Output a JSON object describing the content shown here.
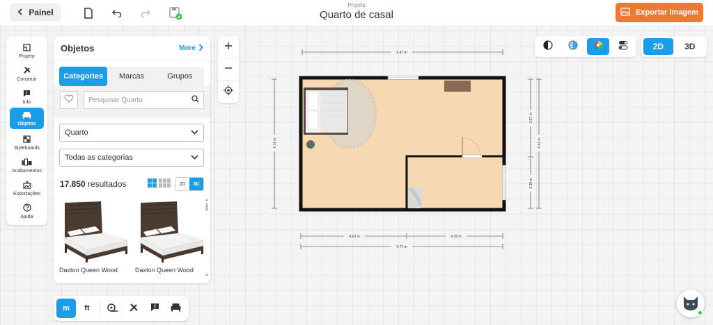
{
  "header": {
    "back_label": "Painel",
    "project_label": "Projeto",
    "project_title": "Quarto de casal",
    "export_label": "Exportar Imagem"
  },
  "sidebar": {
    "items": [
      {
        "label": "Projeto",
        "icon": "project-icon"
      },
      {
        "label": "Construir",
        "icon": "tools-icon"
      },
      {
        "label": "Info",
        "icon": "info-icon"
      },
      {
        "label": "Objetos",
        "icon": "sofa-icon",
        "active": true
      },
      {
        "label": "Styleboards",
        "icon": "styleboard-icon"
      },
      {
        "label": "Acabamentos",
        "icon": "finishes-icon"
      },
      {
        "label": "Exportações",
        "icon": "export-icon"
      },
      {
        "label": "Ajuda",
        "icon": "help-icon"
      }
    ]
  },
  "panel": {
    "title": "Objetos",
    "more_label": "More",
    "tabs": [
      {
        "label": "Categories",
        "active": true
      },
      {
        "label": "Marcas"
      },
      {
        "label": "Grupos"
      }
    ],
    "search_placeholder": "Pesquisar Quarto",
    "room_select": "Quarto",
    "category_select": "Todas as categorias",
    "results_count": "17.850",
    "results_label": "resultados",
    "toggle_2d": "2D",
    "toggle_3d": "3D",
    "products": [
      {
        "name": "Daxton Queen Wood"
      },
      {
        "name": "Daxton Queen Wood"
      }
    ]
  },
  "view_toggle": {
    "two_d": "2D",
    "three_d": "3D",
    "active": "2D"
  },
  "bottom_bar": {
    "unit_m": "m",
    "unit_ft": "ft",
    "active_unit": "m"
  },
  "floorplan": {
    "dims": {
      "top": "9.47 m",
      "bottom_left": "4.93 m",
      "bottom_right": "4.39 m",
      "bottom_total": "9.77 m",
      "left": "6.11 m",
      "right_upper": "3.57 m",
      "right_lower": "2.39 m",
      "right_total": "6.41 m"
    }
  },
  "colors": {
    "accent": "#1a9ee8",
    "export": "#ee7a30",
    "floor": "#f6d9b3",
    "wall": "#111111"
  }
}
